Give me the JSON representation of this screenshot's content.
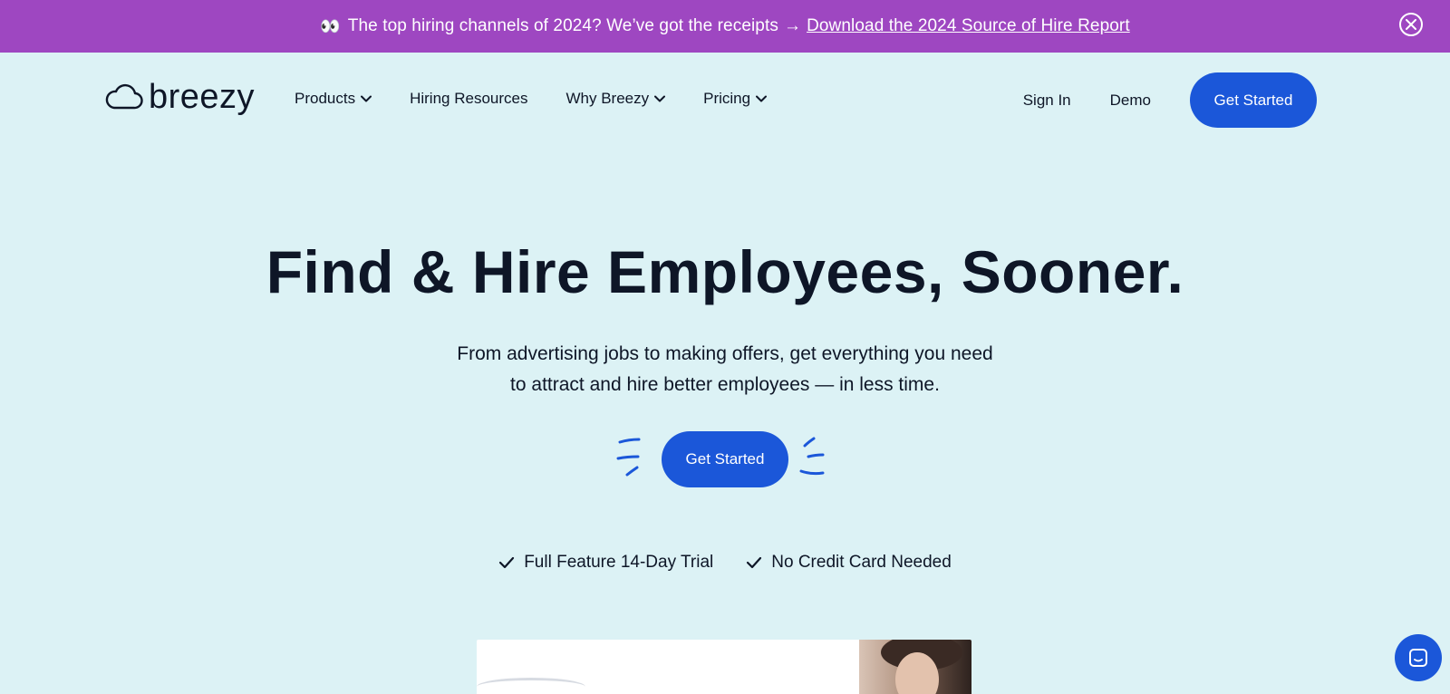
{
  "banner": {
    "emoji": "👀",
    "text": "The top hiring channels of 2024? We’ve got the receipts",
    "arrow": "→",
    "link_text": "Download the 2024 Source of Hire Report",
    "close_icon": "close-icon",
    "background": "#9e47c1"
  },
  "header": {
    "logo_text": "breezy",
    "nav": [
      {
        "label": "Products",
        "has_dropdown": true
      },
      {
        "label": "Hiring Resources",
        "has_dropdown": false
      },
      {
        "label": "Why Breezy",
        "has_dropdown": true
      },
      {
        "label": "Pricing",
        "has_dropdown": true
      }
    ],
    "sign_in": "Sign In",
    "demo": "Demo",
    "cta": "Get Started"
  },
  "hero": {
    "title": "Find & Hire Employees, Sooner.",
    "subtitle_line1": "From advertising jobs to making offers, get everything you need",
    "subtitle_line2": "to attract and hire better employees — in less time.",
    "cta": "Get Started"
  },
  "trial": {
    "items": [
      "Full Feature 14-Day Trial",
      "No Credit Card Needed"
    ]
  },
  "colors": {
    "page_background": "#dcf2f5",
    "accent": "#1b57d9",
    "text": "#0e1627"
  },
  "chat_icon": "chat-icon"
}
